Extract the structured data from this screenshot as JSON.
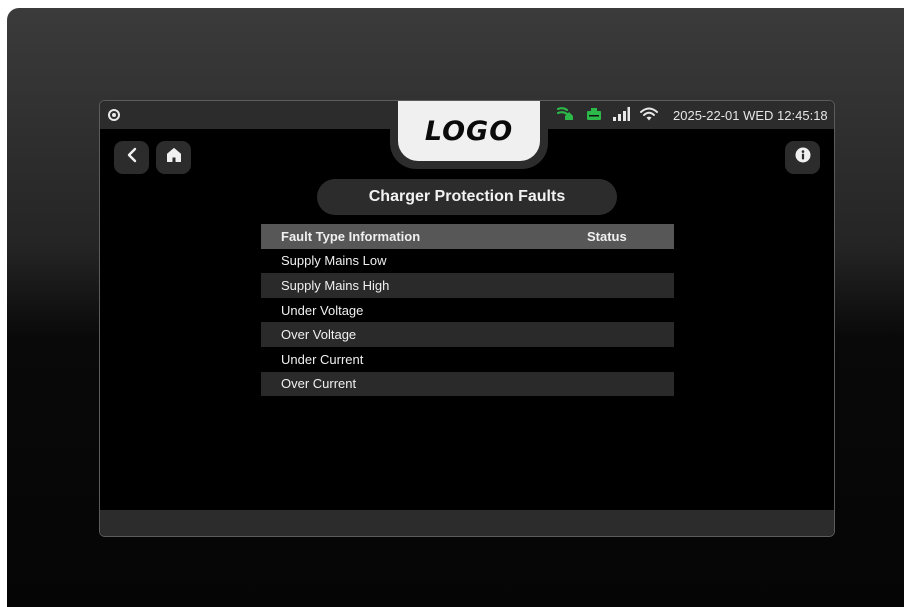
{
  "header": {
    "logo_text": "LOGO",
    "datetime": "2025-22-01 WED 12:45:18",
    "icons": [
      "settings-icon",
      "charging-icon",
      "battery-icon",
      "signal-bars-icon",
      "wifi-icon"
    ],
    "accent_green": "#2db84a"
  },
  "nav": {
    "buttons": [
      "back-arrow-icon",
      "home-icon",
      "info-icon"
    ]
  },
  "page": {
    "title": "Charger Protection Faults"
  },
  "table": {
    "columns": [
      "Fault Type Information",
      "Status"
    ],
    "rows": [
      {
        "type": "Supply Mains Low",
        "status": ""
      },
      {
        "type": "Supply Mains High",
        "status": ""
      },
      {
        "type": "Under Voltage",
        "status": ""
      },
      {
        "type": "Over Voltage",
        "status": ""
      },
      {
        "type": "Under Current",
        "status": ""
      },
      {
        "type": "Over Current",
        "status": ""
      }
    ]
  }
}
